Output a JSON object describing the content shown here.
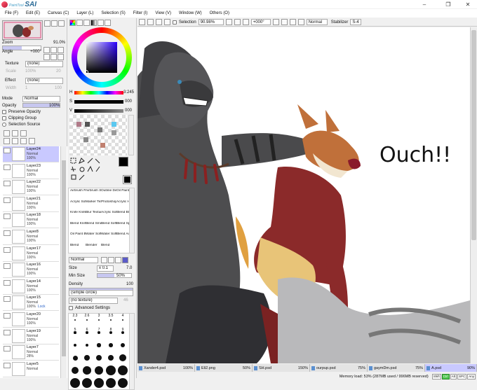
{
  "app": {
    "logo_small": "PaintTool",
    "logo_large": "SAI"
  },
  "window_controls": {
    "minimize": "–",
    "maximize": "❐",
    "close": "✕"
  },
  "menu": [
    "File (F)",
    "Edit (E)",
    "Canvas (C)",
    "Layer (L)",
    "Selection (S)",
    "Filter (I)",
    "View (V)",
    "Window (W)",
    "Others (O)"
  ],
  "navigator": {
    "zoom_label": "Zoom",
    "zoom_value": "91.0%",
    "angle_label": "Angle",
    "angle_value": "+000°"
  },
  "layer_props": {
    "texture_label": "Texture",
    "texture_value": "(none)",
    "scale_label": "Scale",
    "scale_value": "100%",
    "scale_num": "20",
    "effect_label": "Effect",
    "effect_value": "(none)",
    "width_label": "Width",
    "width_value": "1",
    "width_num": "100",
    "mode_label": "Mode",
    "mode_value": "Normal",
    "opacity_label": "Opacity",
    "opacity_value": "100%",
    "preserve_opacity": "Preserve Opacity",
    "clipping_group": "Clipping Group",
    "selection_source": "Selection Source"
  },
  "layers": [
    {
      "name": "Layer24",
      "mode": "Normal",
      "opacity": "100%",
      "selected": true
    },
    {
      "name": "Layer23",
      "mode": "Normal",
      "opacity": "100%"
    },
    {
      "name": "Layer22",
      "mode": "Normal",
      "opacity": "100%"
    },
    {
      "name": "Layer21",
      "mode": "Normal",
      "opacity": "100%"
    },
    {
      "name": "Layer18",
      "mode": "Normal",
      "opacity": "100%"
    },
    {
      "name": "Layer8",
      "mode": "Normal",
      "opacity": "100%"
    },
    {
      "name": "Layer17",
      "mode": "Normal",
      "opacity": "100%"
    },
    {
      "name": "Layer16",
      "mode": "Normal",
      "opacity": "100%"
    },
    {
      "name": "Layer14",
      "mode": "Normal",
      "opacity": "100%"
    },
    {
      "name": "Layer15",
      "mode": "Normal",
      "opacity": "100%",
      "extra": "Lock"
    },
    {
      "name": "Layer20",
      "mode": "Normal",
      "opacity": "100%"
    },
    {
      "name": "Layer19",
      "mode": "Normal",
      "opacity": "100%"
    },
    {
      "name": "Layer7",
      "mode": "Normal",
      "opacity": "28%"
    },
    {
      "name": "Layer5",
      "mode": "Normal",
      "opacity": ""
    }
  ],
  "color": {
    "h_label": "H",
    "h_value": "3:245",
    "s_label": "S",
    "s_value": "000",
    "v_label": "V",
    "v_value": "000",
    "fg": "#000000",
    "bg": "#ffffff"
  },
  "brushes": [
    [
      "Airbrush Pencil",
      "Airbrush Soft",
      "Outline Detail",
      "Oil Paint Blend"
    ],
    [
      "Acrylic Soft",
      "Marker Texture",
      "Photoshop Brush",
      "Acrylic Hard"
    ],
    [
      "Knife Knife",
      "Blur Texture",
      "Acrylic Soft",
      "Blend Blend"
    ],
    [
      "Blend Knife",
      "Blend Smudge",
      "Blend Soft",
      "Blend Sponge"
    ],
    [
      "Oil Paint Blend",
      "Water Soft",
      "Water Soft",
      "Blend Airbrush"
    ],
    [
      "Blend",
      "Blender",
      "Blend",
      ""
    ]
  ],
  "brush_settings": {
    "mode_value": "Normal",
    "size_label": "Size",
    "size_mult": "x 0.1",
    "size_value": "7.0",
    "min_size_label": "Min Size",
    "min_size_value": "50%",
    "density_label": "Density",
    "density_value": "100",
    "shape_value": "(simple circle)",
    "texture_value": "(no texture)",
    "texture_num": "46",
    "advanced": "Advanced Settings"
  },
  "brush_sizes": [
    "2.3",
    "2.6",
    "3",
    "3.5",
    "4",
    "5",
    "6",
    "7",
    "8",
    "9",
    "10",
    "12",
    "14",
    "16",
    "20",
    "25",
    "30",
    "35",
    "40",
    "50",
    "60",
    "70",
    "80",
    "100",
    "120",
    "150",
    "200",
    "250",
    "300",
    "350"
  ],
  "toolbar": {
    "selection_label": "Selection",
    "zoom": "90.98%",
    "angle": "+000°",
    "mode": "Normal",
    "stabilizer_label": "Stabilizer",
    "stabilizer_value": "S-4"
  },
  "canvas": {
    "speech_text": "Ouch!!"
  },
  "tabs": [
    {
      "name": "Xander4.psd",
      "zoom": "100%"
    },
    {
      "name": "Eli2.png",
      "zoom": "50%"
    },
    {
      "name": "SH.psd",
      "zoom": "150%"
    },
    {
      "name": "ourpup.psd",
      "zoom": "75%"
    },
    {
      "name": "gaymDm.psd",
      "zoom": "75%"
    },
    {
      "name": "A.psd",
      "zoom": "90%",
      "active": true
    }
  ],
  "status": {
    "memory": "Memory load: 53% (287MB used / 996MB reserved)",
    "keys": [
      "Shift",
      "Ctrl",
      "Alt",
      "SPC",
      "Any"
    ]
  }
}
